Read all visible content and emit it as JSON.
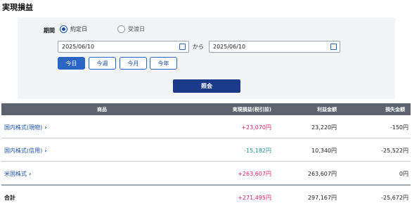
{
  "page": {
    "title": "実現損益"
  },
  "filter": {
    "period_label": "期間",
    "radio_contract": "約定日",
    "radio_delivery": "受渡日",
    "selected": "約定日",
    "date_from": "2025/06/10",
    "date_to": "2025/06/10",
    "separator": "から",
    "chips": {
      "today": "今日",
      "week": "今週",
      "month": "今月",
      "year": "今年"
    },
    "active_chip": "今日",
    "query_button": "照会"
  },
  "table": {
    "headers": {
      "product": "商品",
      "realized": "実現損益(税引前)",
      "profit": "利益金額",
      "loss": "損失金額"
    },
    "rows": [
      {
        "product": "国内株式(現物)",
        "realized": "+23,070円",
        "profit": "23,220円",
        "loss": "-150円"
      },
      {
        "product": "国内株式(信用)",
        "realized": "-15,182円",
        "profit": "10,340円",
        "loss": "-25,522円"
      },
      {
        "product": "米国株式",
        "realized": "+263,607円",
        "profit": "263,607円",
        "loss": "0円"
      }
    ],
    "total": {
      "label": "合計",
      "realized": "+271,495円",
      "profit": "297,167円",
      "loss": "-25,672円"
    }
  },
  "colors": {
    "positive": "#d6245e",
    "negative": "#1f8e8f",
    "accent": "#1a4fa3",
    "header_bg": "#5d6470",
    "button_bg": "#1c3a8a"
  },
  "icons": {
    "calendar": "calendar-icon",
    "chevron": "chevron-right-icon"
  }
}
